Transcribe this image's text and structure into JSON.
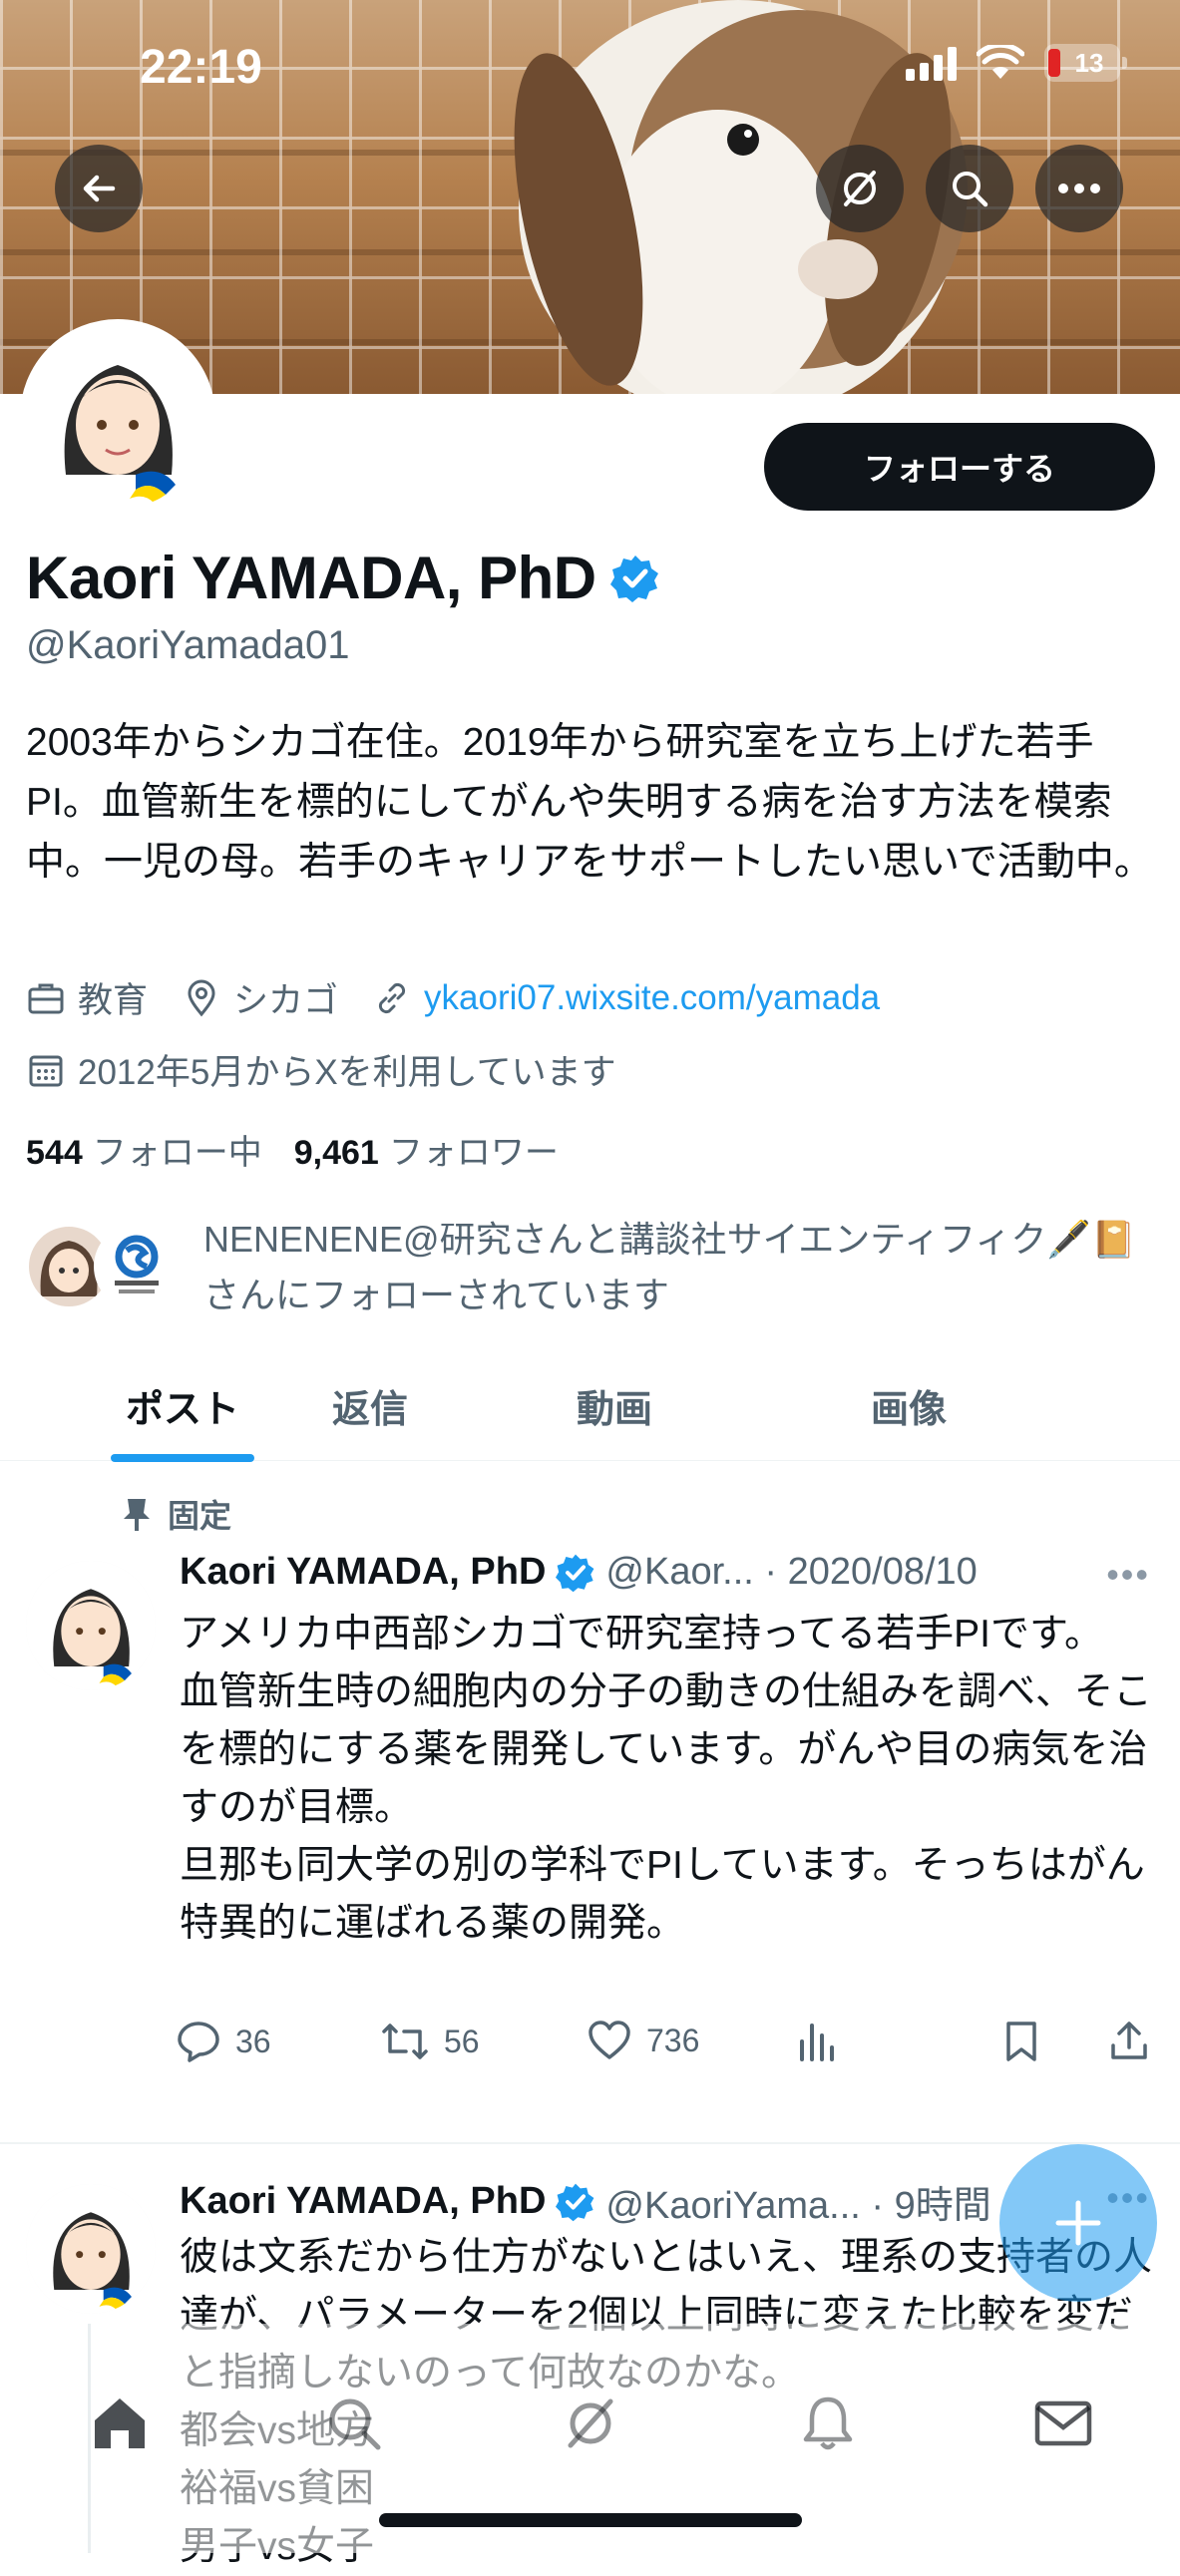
{
  "status_bar": {
    "time": "22:19",
    "battery": "13"
  },
  "header": {
    "back_icon": "arrow-left-icon",
    "grok_icon": "grok-icon",
    "search_icon": "search-icon",
    "more_icon": "more-icon"
  },
  "profile": {
    "follow_label": "フォローする",
    "name": "Kaori YAMADA, PhD",
    "handle": "@KaoriYamada01",
    "bio": "2003年からシカゴ在住。2019年から研究室を立ち上げた若手PI。血管新生を標的にしてがんや失明する病を治す方法を模索中。一児の母。若手のキャリアをサポートしたい思いで活動中。",
    "category": "教育",
    "location": "シカゴ",
    "website": "ykaori07.wixsite.com/yamada",
    "joined": "2012年5月からXを利用しています",
    "following_count": "544",
    "following_label": "フォロー中",
    "followers_count": "9,461",
    "followers_label": "フォロワー",
    "followed_by": "NENENENE@研究さんと講談社サイエンティフィク🖋️📔さんにフォローされています"
  },
  "tabs": [
    {
      "label": "ポスト",
      "active": true
    },
    {
      "label": "返信",
      "active": false
    },
    {
      "label": "動画",
      "active": false
    },
    {
      "label": "画像",
      "active": false
    }
  ],
  "posts": [
    {
      "pinned_label": "固定",
      "name": "Kaori YAMADA, PhD",
      "meta": "@Kaor... · 2020/08/10",
      "text": "アメリカ中西部シカゴで研究室持ってる若手PIです。\n血管新生時の細胞内の分子の動きの仕組みを調べ、そこを標的にする薬を開発しています。がんや目の病気を治すのが目標。\n旦那も同大学の別の学科でPIしています。そっちはがん特異的に運ばれる薬の開発。",
      "replies": "36",
      "reposts": "56",
      "likes": "736"
    },
    {
      "name": "Kaori YAMADA, PhD",
      "meta": "@KaoriYama... · 9時間",
      "text": "彼は文系だから仕方がないとはいえ、理系の支持者の人達が、パラメーターを2個以上同時に変えた比較を変だと指摘しないのって何故なのかな。\n都会vs地方\n裕福vs貧困\n男子vs女子"
    }
  ],
  "colors": {
    "accent": "#1d9bf0",
    "text": "#0f1419",
    "muted": "#536471",
    "follow_button": "#0f1419"
  }
}
